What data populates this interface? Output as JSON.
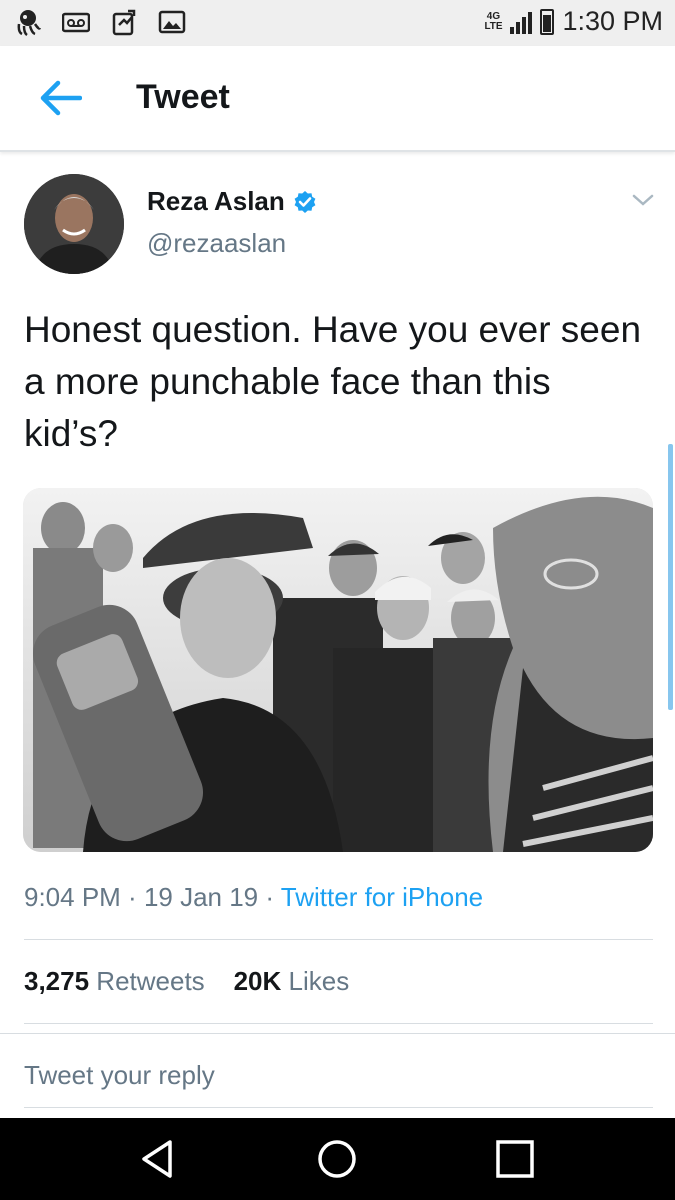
{
  "status_bar": {
    "time": "1:30 PM",
    "network": "4G LTE",
    "left_icons": [
      "octopus-icon",
      "voicemail-icon",
      "sync-icon",
      "image-icon"
    ],
    "right_icons": [
      "signal-icon",
      "battery-icon"
    ]
  },
  "header": {
    "title": "Tweet",
    "back_icon": "back-arrow-icon"
  },
  "tweet": {
    "author_name": "Reza Aslan",
    "handle": "@rezaaslan",
    "verified": true,
    "text": "Honest question. Have you ever seen a more punchable face than this kid’s?",
    "time": "9:04 PM",
    "sep1": " · ",
    "date": "19 Jan 19",
    "sep2": " · ",
    "source": "Twitter for iPhone",
    "retweets_count": "3,275",
    "retweets_label": " Retweets",
    "likes_count": "20K",
    "likes_label": " Likes",
    "reply_placeholder": "Tweet your reply"
  },
  "colors": {
    "accent": "#1da1f2",
    "secondary_text": "#657786",
    "primary_text": "#14171a"
  },
  "nav_bar": {
    "icons": [
      "nav-back-icon",
      "nav-home-icon",
      "nav-recents-icon"
    ]
  }
}
